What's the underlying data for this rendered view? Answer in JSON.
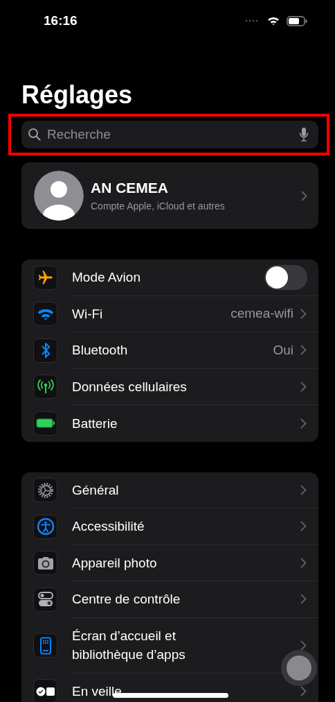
{
  "status_bar": {
    "time": "16:16"
  },
  "title": "Réglages",
  "search": {
    "placeholder": "Recherche"
  },
  "profile": {
    "name": "AN CEMEA",
    "subtitle": "Compte Apple, iCloud et autres"
  },
  "groups": [
    {
      "rows": [
        {
          "kind": "toggle",
          "label": "Mode Avion",
          "on": false
        },
        {
          "kind": "link",
          "label": "Wi-Fi",
          "value": "cemea-wifi"
        },
        {
          "kind": "link",
          "label": "Bluetooth",
          "value": "Oui"
        },
        {
          "kind": "link",
          "label": "Données cellulaires"
        },
        {
          "kind": "link",
          "label": "Batterie"
        }
      ]
    },
    {
      "rows": [
        {
          "kind": "link",
          "label": "Général"
        },
        {
          "kind": "link",
          "label": "Accessibilité"
        },
        {
          "kind": "link",
          "label": "Appareil photo"
        },
        {
          "kind": "link",
          "label": "Centre de contrôle"
        },
        {
          "kind": "link",
          "label": "Écran d’accueil et bibliothèque d’apps"
        },
        {
          "kind": "link",
          "label": "En veille"
        }
      ]
    }
  ]
}
